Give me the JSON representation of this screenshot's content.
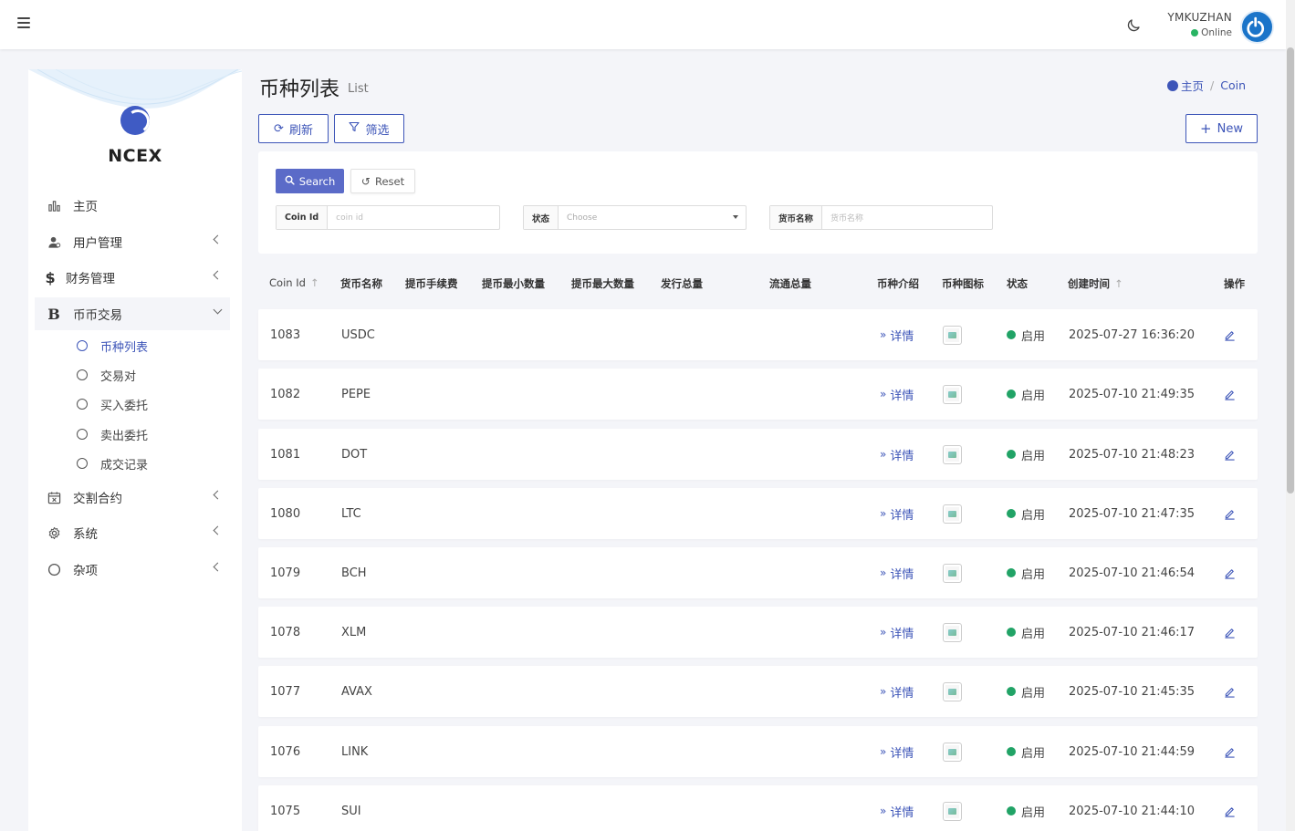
{
  "header": {
    "username": "YMKUZHAN",
    "status": "Online"
  },
  "sidebar": {
    "logo": "NCEX",
    "items": [
      {
        "label": "主页",
        "icon": "bar-chart-icon"
      },
      {
        "label": "用户管理",
        "icon": "users-icon"
      },
      {
        "label": "财务管理",
        "icon": "dollar-icon"
      },
      {
        "label": "币币交易",
        "icon": "bitcoin-icon"
      },
      {
        "label": "交割合约",
        "icon": "calendar-icon"
      },
      {
        "label": "系统",
        "icon": "gear-icon"
      },
      {
        "label": "杂项",
        "icon": "circle-icon"
      }
    ],
    "sub_items": [
      "币种列表",
      "交易对",
      "买入委托",
      "卖出委托",
      "成交记录"
    ]
  },
  "page": {
    "title": "币种列表",
    "subtitle": "List",
    "breadcrumb": [
      "主页",
      "Coin"
    ],
    "refresh_label": "刷新",
    "filter_label": "筛选",
    "new_label": "New"
  },
  "filter": {
    "search_label": "Search",
    "reset_label": "Reset",
    "fields": [
      {
        "label": "Coin Id",
        "placeholder": "coin id"
      },
      {
        "label": "状态",
        "placeholder": "Choose"
      },
      {
        "label": "货币名称",
        "placeholder": "货币名称"
      }
    ]
  },
  "table": {
    "columns": [
      "Coin Id",
      "货币名称",
      "提币手续费",
      "提币最小数量",
      "提币最大数量",
      "发行总量",
      "流通总量",
      "币种介绍",
      "币种图标",
      "状态",
      "创建时间",
      "操作"
    ],
    "detail_label": "详情",
    "rows": [
      {
        "id": "1083",
        "name": "USDC",
        "status": "启用",
        "created": "2025-07-27 16:36:20"
      },
      {
        "id": "1082",
        "name": "PEPE",
        "status": "启用",
        "created": "2025-07-10 21:49:35"
      },
      {
        "id": "1081",
        "name": "DOT",
        "status": "启用",
        "created": "2025-07-10 21:48:23"
      },
      {
        "id": "1080",
        "name": "LTC",
        "status": "启用",
        "created": "2025-07-10 21:47:35"
      },
      {
        "id": "1079",
        "name": "BCH",
        "status": "启用",
        "created": "2025-07-10 21:46:54"
      },
      {
        "id": "1078",
        "name": "XLM",
        "status": "启用",
        "created": "2025-07-10 21:46:17"
      },
      {
        "id": "1077",
        "name": "AVAX",
        "status": "启用",
        "created": "2025-07-10 21:45:35"
      },
      {
        "id": "1076",
        "name": "LINK",
        "status": "启用",
        "created": "2025-07-10 21:44:59"
      },
      {
        "id": "1075",
        "name": "SUI",
        "status": "启用",
        "created": "2025-07-10 21:44:10"
      }
    ]
  }
}
